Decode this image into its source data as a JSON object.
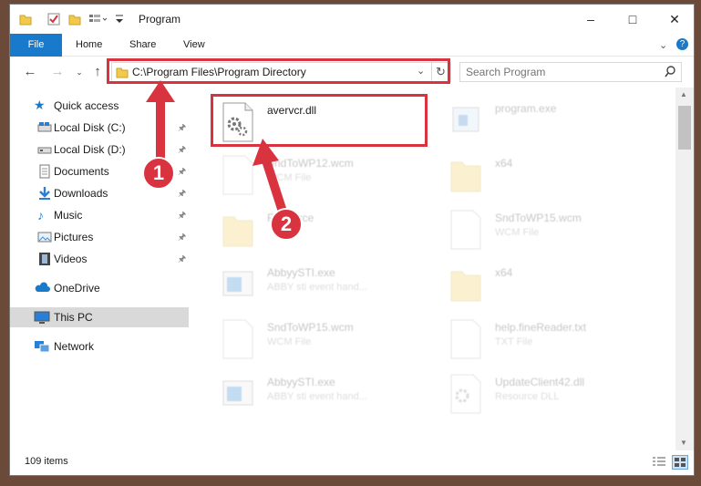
{
  "window": {
    "title": "Program"
  },
  "ribbon": {
    "tabs": [
      "File",
      "Home",
      "Share",
      "View"
    ]
  },
  "address": {
    "path": "C:\\Program Files\\Program Directory"
  },
  "search": {
    "placeholder": "Search Program"
  },
  "sidebar": {
    "items": [
      {
        "label": "Quick access",
        "icon": "star-icon",
        "pinned": false
      },
      {
        "label": "Local Disk (C:)",
        "icon": "drive-icon",
        "pinned": true
      },
      {
        "label": "Local Disk (D:)",
        "icon": "drive-icon",
        "pinned": true
      },
      {
        "label": "Documents",
        "icon": "documents-icon",
        "pinned": true
      },
      {
        "label": "Downloads",
        "icon": "download-icon",
        "pinned": true
      },
      {
        "label": "Music",
        "icon": "music-icon",
        "pinned": true
      },
      {
        "label": "Pictures",
        "icon": "pictures-icon",
        "pinned": true
      },
      {
        "label": "Videos",
        "icon": "videos-icon",
        "pinned": true
      },
      {
        "label": "OneDrive",
        "icon": "cloud-icon",
        "pinned": false
      },
      {
        "label": "This PC",
        "icon": "computer-icon",
        "pinned": false,
        "selected": true
      },
      {
        "label": "Network",
        "icon": "network-icon",
        "pinned": false
      }
    ]
  },
  "files": [
    {
      "name": "avervcr.dll",
      "type": "",
      "icon": "dll-gear-icon",
      "highlighted": true
    },
    {
      "name": "program.exe",
      "type": "",
      "icon": "exe-icon"
    },
    {
      "name": "SndToWP12.wcm",
      "type": "WCM File",
      "icon": "file-icon"
    },
    {
      "name": "x64",
      "type": "",
      "icon": "folder-icon"
    },
    {
      "name": "Resource",
      "type": "",
      "icon": "folder-icon"
    },
    {
      "name": "SndToWP15.wcm",
      "type": "WCM File",
      "icon": "file-icon"
    },
    {
      "name": "AbbyySTI.exe",
      "type": "ABBY sti event hand...",
      "icon": "exe-icon"
    },
    {
      "name": "x64",
      "type": "",
      "icon": "folder-icon"
    },
    {
      "name": "SndToWP15.wcm",
      "type": "WCM File",
      "icon": "file-icon"
    },
    {
      "name": "help.fineReader.txt",
      "type": "TXT File",
      "icon": "file-icon"
    },
    {
      "name": "AbbyySTI.exe",
      "type": "ABBY sti event hand...",
      "icon": "exe-icon"
    },
    {
      "name": "UpdateClient42.dll",
      "type": "Resource DLL",
      "icon": "dll-gear-icon"
    }
  ],
  "status": {
    "count": "109 items"
  },
  "callouts": {
    "one": "1",
    "two": "2"
  },
  "colors": {
    "accent": "#1979ca",
    "highlight": "#d9333f"
  }
}
